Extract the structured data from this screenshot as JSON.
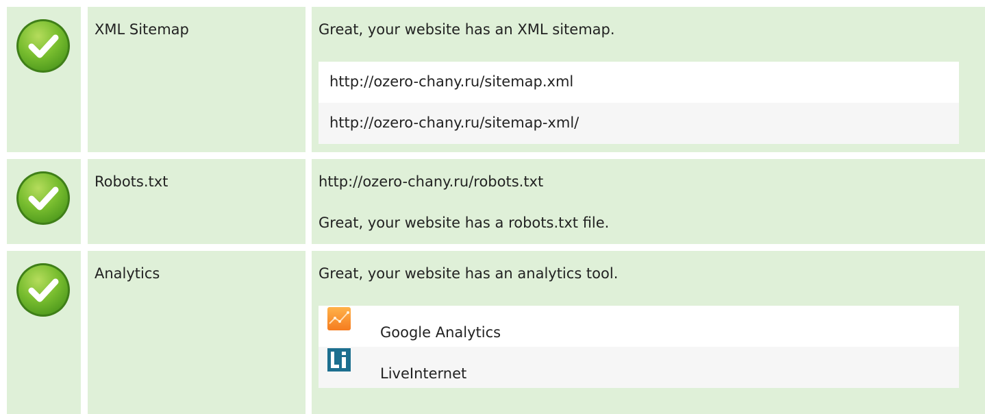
{
  "colors": {
    "row_background": "#dff0d8",
    "list_odd": "#ffffff",
    "list_even": "#f6f6f6",
    "check_green": "#6db33f"
  },
  "rows": [
    {
      "status_icon": "check-circle-icon",
      "label": "XML Sitemap",
      "message": "Great, your website has an XML sitemap.",
      "items": [
        "http://ozero-chany.ru/sitemap.xml",
        "http://ozero-chany.ru/sitemap-xml/"
      ]
    },
    {
      "status_icon": "check-circle-icon",
      "label": "Robots.txt",
      "url": "http://ozero-chany.ru/robots.txt",
      "message": "Great, your website has a robots.txt file."
    },
    {
      "status_icon": "check-circle-icon",
      "label": "Analytics",
      "message": "Great, your website has an analytics tool.",
      "tools": [
        {
          "icon": "google-analytics-icon",
          "name": "Google Analytics"
        },
        {
          "icon": "liveinternet-icon",
          "name": "LiveInternet"
        }
      ]
    }
  ]
}
